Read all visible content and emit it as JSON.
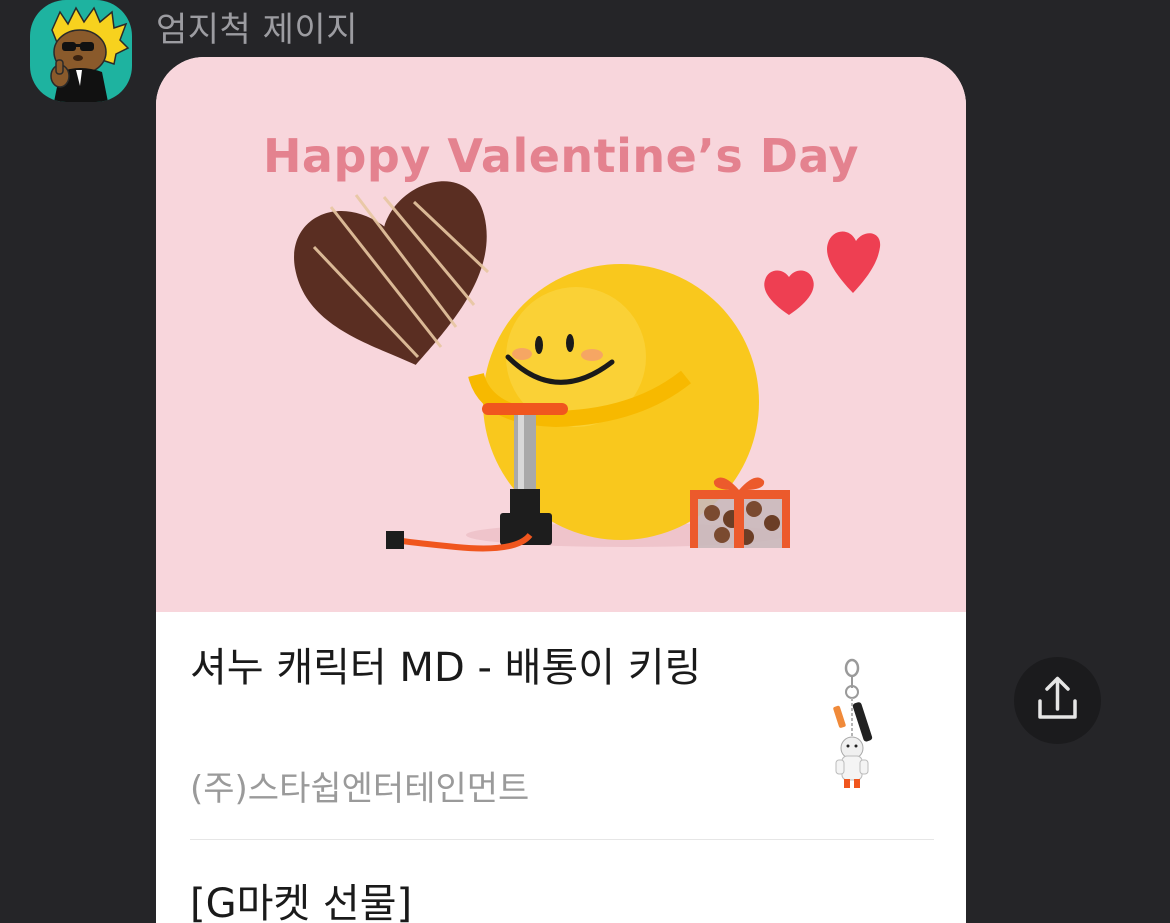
{
  "message": {
    "sender_name": "엄지척 제이지",
    "avatar_icon": "character-avatar-icon"
  },
  "card": {
    "banner_title": "Happy Valentine’s Day",
    "banner_colors": {
      "background": "#f8d6dc",
      "title": "#e4828f"
    },
    "product_title": "셔누 캐릭터 MD - 배통이 키링",
    "product_company": "(주)스타쉽엔터테인먼트",
    "product_thumbnail_icon": "keyring-thumbnail-icon",
    "gift_title": "[G마켓 선물]"
  },
  "share_button": {
    "icon": "share-icon"
  }
}
